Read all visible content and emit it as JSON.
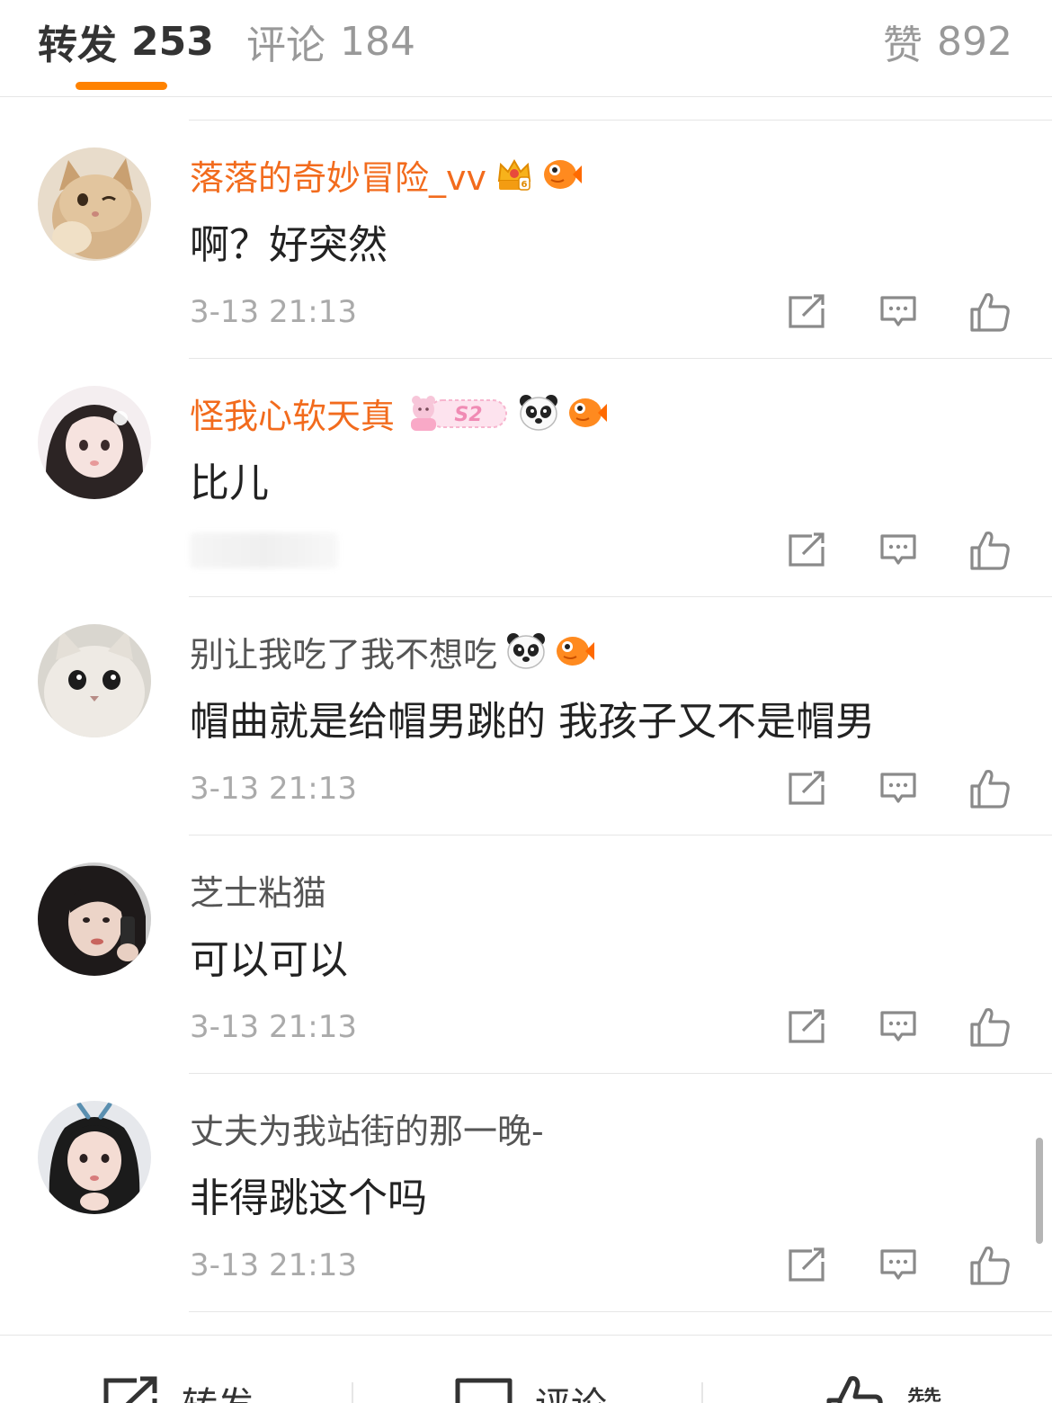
{
  "tabs": {
    "forward": {
      "label": "转发",
      "count": "253"
    },
    "comment": {
      "label": "评论",
      "count": "184"
    },
    "like": {
      "label": "赞",
      "count": "892"
    },
    "active": "forward",
    "accent_color": "#ff8200"
  },
  "comments": [
    {
      "name": "落落的奇妙冒险_vv",
      "vip": true,
      "badges": [
        "crown-level-6-badge",
        "fish-badge"
      ],
      "text": "啊？好突然",
      "time": "3-13 21:13"
    },
    {
      "name": "怪我心软天真",
      "vip": true,
      "badges": [
        "pink-s2-badge",
        "panda-badge",
        "fish-badge"
      ],
      "text": "比儿",
      "time": ""
    },
    {
      "name": "别让我吃了我不想吃",
      "vip": false,
      "badges": [
        "panda-badge",
        "fish-badge"
      ],
      "text": "帽曲就是给帽男跳的 我孩子又不是帽男",
      "time": "3-13 21:13"
    },
    {
      "name": "芝士粘猫",
      "vip": false,
      "badges": [],
      "text": "可以可以",
      "time": "3-13 21:13"
    },
    {
      "name": "丈夫为我站街的那一晚-",
      "vip": false,
      "badges": [],
      "text": "非得跳这个吗",
      "time": "3-13 21:13"
    }
  ],
  "toolbar": {
    "forward_label": "转发",
    "comment_label": "评论",
    "like_label": "赞"
  },
  "colors": {
    "vip_name": "#f26b1d",
    "name": "#555555",
    "time": "#aaaaaa"
  }
}
